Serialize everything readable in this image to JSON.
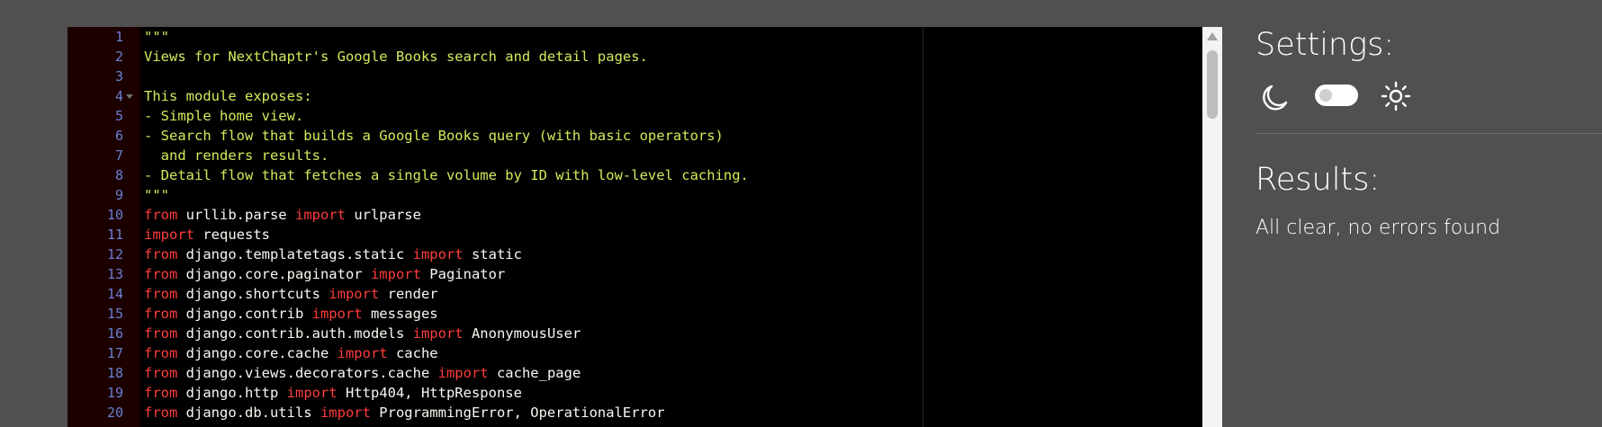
{
  "editor": {
    "line_numbers": [
      "1",
      "2",
      "3",
      "4",
      "5",
      "6",
      "7",
      "8",
      "9",
      "10",
      "11",
      "12",
      "13",
      "14",
      "15",
      "16",
      "17",
      "18",
      "19",
      "20"
    ],
    "lines": [
      [
        {
          "t": "\"\"\"",
          "c": "doc"
        }
      ],
      [
        {
          "t": "Views for NextChaptr's Google Books search and detail pages.",
          "c": "doc"
        }
      ],
      [],
      [
        {
          "t": "This module exposes:",
          "c": "doc"
        }
      ],
      [
        {
          "t": "- Simple home view.",
          "c": "doc"
        }
      ],
      [
        {
          "t": "- Search flow that builds a Google Books query (with basic operators)",
          "c": "doc"
        }
      ],
      [
        {
          "t": "  and renders results.",
          "c": "doc"
        }
      ],
      [
        {
          "t": "- Detail flow that fetches a single volume by ID with low-level caching.",
          "c": "doc"
        }
      ],
      [
        {
          "t": "\"\"\"",
          "c": "doc"
        }
      ],
      [
        {
          "t": "from",
          "c": "kw"
        },
        {
          "t": " urllib.parse ",
          "c": "txt"
        },
        {
          "t": "import",
          "c": "kw"
        },
        {
          "t": " urlparse",
          "c": "txt"
        }
      ],
      [
        {
          "t": "import",
          "c": "kw"
        },
        {
          "t": " requests",
          "c": "txt"
        }
      ],
      [
        {
          "t": "from",
          "c": "kw"
        },
        {
          "t": " django.templatetags.static ",
          "c": "txt"
        },
        {
          "t": "import",
          "c": "kw"
        },
        {
          "t": " static",
          "c": "txt"
        }
      ],
      [
        {
          "t": "from",
          "c": "kw"
        },
        {
          "t": " django.core.paginator ",
          "c": "txt"
        },
        {
          "t": "import",
          "c": "kw"
        },
        {
          "t": " Paginator",
          "c": "txt"
        }
      ],
      [
        {
          "t": "from",
          "c": "kw"
        },
        {
          "t": " django.shortcuts ",
          "c": "txt"
        },
        {
          "t": "import",
          "c": "kw"
        },
        {
          "t": " render",
          "c": "txt"
        }
      ],
      [
        {
          "t": "from",
          "c": "kw"
        },
        {
          "t": " django.contrib ",
          "c": "txt"
        },
        {
          "t": "import",
          "c": "kw"
        },
        {
          "t": " messages",
          "c": "txt"
        }
      ],
      [
        {
          "t": "from",
          "c": "kw"
        },
        {
          "t": " django.contrib.auth.models ",
          "c": "txt"
        },
        {
          "t": "import",
          "c": "kw"
        },
        {
          "t": " AnonymousUser",
          "c": "txt"
        }
      ],
      [
        {
          "t": "from",
          "c": "kw"
        },
        {
          "t": " django.core.cache ",
          "c": "txt"
        },
        {
          "t": "import",
          "c": "kw"
        },
        {
          "t": " cache",
          "c": "txt"
        }
      ],
      [
        {
          "t": "from",
          "c": "kw"
        },
        {
          "t": " django.views.decorators.cache ",
          "c": "txt"
        },
        {
          "t": "import",
          "c": "kw"
        },
        {
          "t": " cache_page",
          "c": "txt"
        }
      ],
      [
        {
          "t": "from",
          "c": "kw"
        },
        {
          "t": " django.http ",
          "c": "txt"
        },
        {
          "t": "import",
          "c": "kw"
        },
        {
          "t": " Http404, HttpResponse",
          "c": "txt"
        }
      ],
      [
        {
          "t": "from",
          "c": "kw"
        },
        {
          "t": " django.db.utils ",
          "c": "txt"
        },
        {
          "t": "import",
          "c": "kw"
        },
        {
          "t": " ProgrammingError, OperationalError",
          "c": "txt"
        }
      ]
    ],
    "fold_marker_line": "4",
    "colors": {
      "docstring": "#d6e95a",
      "keyword": "#ff3d3d",
      "gutter_bg": "#1c0000",
      "line_number": "#6a7fd0"
    }
  },
  "panel": {
    "settings_title": "Settings:",
    "theme_icons": [
      "moon-icon",
      "sun-icon"
    ],
    "results_title": "Results:",
    "results_text": "All clear, no errors found"
  }
}
